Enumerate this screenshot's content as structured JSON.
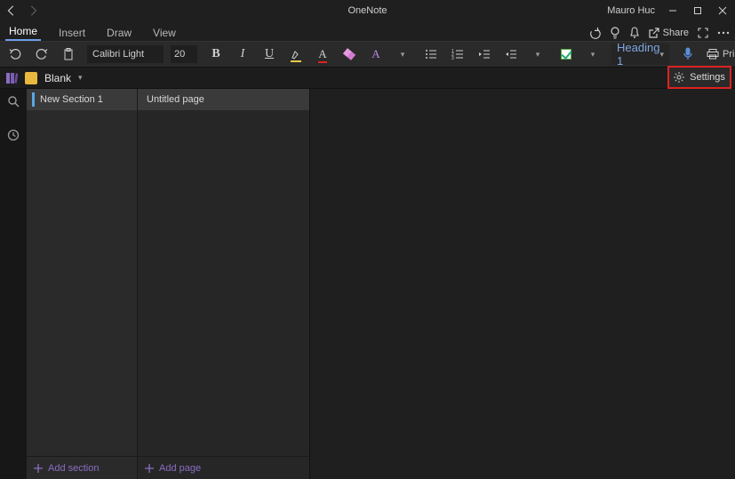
{
  "titlebar": {
    "app": "OneNote",
    "user": "Mauro Huc"
  },
  "tabs": {
    "home": "Home",
    "insert": "Insert",
    "draw": "Draw",
    "view": "View"
  },
  "tabright": {
    "share": "Share"
  },
  "ribbon": {
    "font_name": "Calibri Light",
    "font_size": "20",
    "style_select": "Heading 1",
    "print": "Print"
  },
  "notebook": {
    "name": "Blank"
  },
  "popup": {
    "settings": "Settings"
  },
  "sections": {
    "item0": "New Section 1",
    "add": "Add section"
  },
  "pages": {
    "item0": "Untitled page",
    "add": "Add page"
  }
}
